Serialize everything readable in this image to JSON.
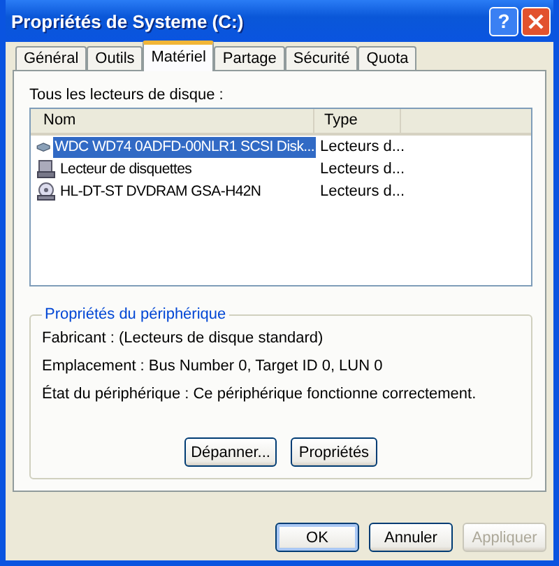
{
  "window": {
    "title": "Propriétés de Systeme (C:)",
    "help_button": "?"
  },
  "tabs": [
    {
      "label": "Général",
      "selected": false
    },
    {
      "label": "Outils",
      "selected": false
    },
    {
      "label": "Matériel",
      "selected": true
    },
    {
      "label": "Partage",
      "selected": false
    },
    {
      "label": "Sécurité",
      "selected": false
    },
    {
      "label": "Quota",
      "selected": false
    }
  ],
  "devices_label": "Tous les lecteurs de disque :",
  "table": {
    "columns": [
      "Nom",
      "Type"
    ],
    "rows": [
      {
        "kind": "disk",
        "name": "WDC WD74 0ADFD-00NLR1 SCSI Disk...",
        "type": "Lecteurs d...",
        "selected": true
      },
      {
        "kind": "floppy",
        "name": "Lecteur de disquettes",
        "type": "Lecteurs d...",
        "selected": false
      },
      {
        "kind": "optical",
        "name": "HL-DT-ST DVDRAM GSA-H42N",
        "type": "Lecteurs d...",
        "selected": false
      }
    ]
  },
  "properties": {
    "title": "Propriétés du périphérique",
    "lines": [
      "Fabricant : (Lecteurs de disque standard)",
      "Emplacement : Bus Number 0, Target ID 0, LUN 0",
      "État du périphérique : Ce périphérique fonctionne correctement."
    ],
    "buttons": [
      {
        "label": "Dépanner...",
        "disabled": false
      },
      {
        "label": "Propriétés",
        "disabled": false
      }
    ]
  },
  "buttons": [
    {
      "label": "OK",
      "disabled": false,
      "default": true
    },
    {
      "label": "Annuler",
      "disabled": false,
      "default": false
    },
    {
      "label": "Appliquer",
      "disabled": true,
      "default": false
    }
  ]
}
